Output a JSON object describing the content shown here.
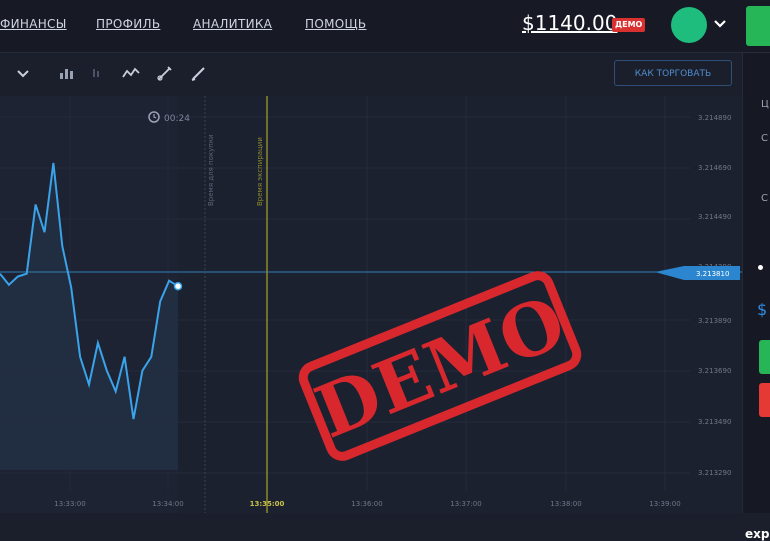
{
  "header": {
    "nav": [
      "ФИНАНСЫ",
      "ПРОФИЛЬ",
      "АНАЛИТИКА",
      "ПОМОЩЬ"
    ],
    "balance": "$1140.00",
    "demo_badge": "ДЕМО"
  },
  "toolbar": {
    "how_to_trade": "КАК ТОРГОВАТЬ"
  },
  "chart": {
    "timer": "00:24",
    "vertical_labels": [
      "Время для покупки",
      "Время экспирации"
    ],
    "price_ticks": [
      "3.214890",
      "3.214690",
      "3.214490",
      "3.214290",
      "3.213810",
      "3.213890",
      "3.213690",
      "3.213490",
      "3.213290"
    ],
    "current_price": "3.213810",
    "time_ticks": [
      "13:33:00",
      "13:34:00",
      "13:35:00",
      "13:36:00",
      "13:37:00",
      "13:38:00",
      "13:39:00"
    ],
    "stamp": "DEMO",
    "line_color": "#3aa3ea"
  },
  "chart_data": {
    "type": "line",
    "series": [
      {
        "values": [
          3.2139,
          3.21382,
          3.21388,
          3.2139,
          3.2144,
          3.2142,
          3.2147,
          3.2141,
          3.2138,
          3.2133,
          3.2131,
          3.2134,
          3.2132,
          3.21305,
          3.2133,
          3.21285,
          3.2132,
          3.2133,
          3.2137,
          3.21385,
          3.21381
        ]
      }
    ],
    "y_ticks": [
      3.21489,
      3.21469,
      3.21449,
      3.21429,
      3.21381,
      3.21389,
      3.21369,
      3.21349,
      3.21329
    ],
    "x_ticks": [
      "13:33:00",
      "13:34:00",
      "13:35:00",
      "13:36:00",
      "13:37:00",
      "13:38:00",
      "13:39:00"
    ],
    "grid": true
  },
  "right_panel": {
    "dollar": "$",
    "exp": "exp"
  }
}
